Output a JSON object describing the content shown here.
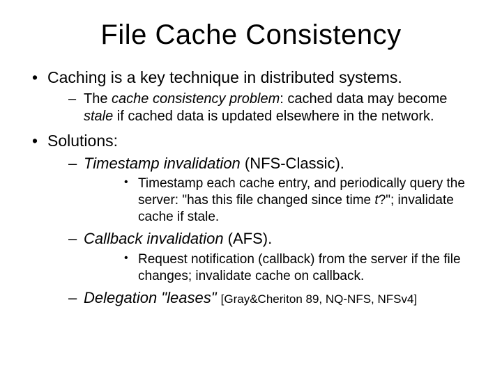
{
  "title": "File Cache Consistency",
  "b1": {
    "text": "Caching is a key technique in distributed systems.",
    "sub1_pre": "The ",
    "sub1_em": "cache consistency problem",
    "sub1_mid": ": cached data may become ",
    "sub1_em2": "stale",
    "sub1_post": " if cached data is updated elsewhere in the network."
  },
  "b2": {
    "text": "Solutions:",
    "s1_em": "Timestamp invalidation",
    "s1_post": " (NFS-Classic).",
    "s1_detail_pre": "Timestamp each cache entry, and periodically query the server: \"has this file changed since time ",
    "s1_detail_em": "t",
    "s1_detail_post": "?\"; invalidate cache if stale.",
    "s2_em": "Callback invalidation",
    "s2_post": " (AFS).",
    "s2_detail": "Request notification (callback) from the server if the file changes; invalidate cache on callback.",
    "s3_em": "Delegation \"leases\"",
    "s3_post": " ",
    "s3_ref": "[Gray&Cheriton 89, NQ-NFS, NFSv4]"
  }
}
